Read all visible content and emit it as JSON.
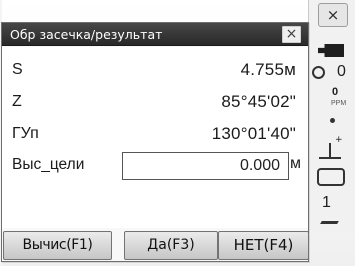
{
  "background": {
    "close_label": "×",
    "status": {
      "battery_icon": "battery-icon",
      "disc_value": "0",
      "ppm_value": "0",
      "ppm_label": "PPM",
      "level_value": "1"
    }
  },
  "dialog": {
    "title": "Обр засечка/результат",
    "close_label": "×",
    "rows": [
      {
        "label": "S",
        "value": "4.755м"
      },
      {
        "label": "Z",
        "value": "85°45'02\""
      },
      {
        "label": "ГУп",
        "value": "130°01'40\""
      }
    ],
    "target_height": {
      "label": "Выс_цели",
      "value": "0.000",
      "unit": "м"
    },
    "softkeys": {
      "compute": "Вычис(F1)",
      "yes": "Да(F3)",
      "no": "НЕТ(F4)"
    }
  },
  "colors": {
    "titlebar": "#292929",
    "dialog_background": "#ffffff",
    "button_face": "#d9d9d9"
  }
}
